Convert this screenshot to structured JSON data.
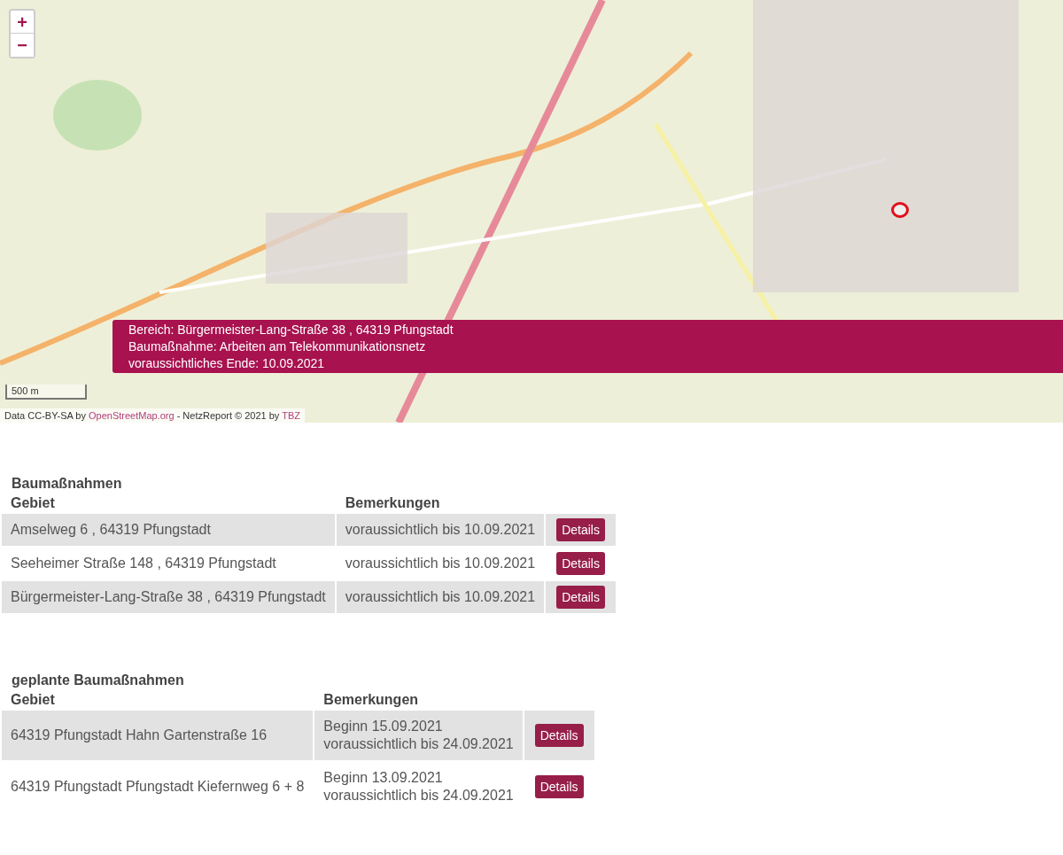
{
  "map": {
    "zoom_controls": [
      "+",
      "−"
    ],
    "tooltip": [
      "Bereich: Bürgermeister-Lang-Straße 38 , 64319 Pfungstadt",
      "Baumaßnahme: Arbeiten am Telekommunikationsnetz",
      "voraussichtliches Ende: 10.09.2021"
    ],
    "scale": "500 m",
    "attribution": [
      {
        "kind": "text",
        "text": "Data CC-BY-SA by "
      },
      {
        "kind": "link",
        "text": "OpenStreetMap.org"
      },
      {
        "kind": "text",
        "text": " - NetzReport © 2021 by "
      },
      {
        "kind": "link",
        "text": "TBZ"
      }
    ]
  },
  "tables": [
    {
      "title": "Baumaßnahmen",
      "columns": [
        "Gebiet",
        "Bemerkungen"
      ],
      "rows": [
        {
          "gebiet": "Amselweg 6 , 64319 Pfungstadt",
          "bemerkungen": [
            "voraussichtlich bis 10.09.2021"
          ],
          "button": "Details"
        },
        {
          "gebiet": "Seeheimer Straße 148 , 64319 Pfungstadt",
          "bemerkungen": [
            "voraussichtlich bis 10.09.2021"
          ],
          "button": "Details"
        },
        {
          "gebiet": "Bürgermeister-Lang-Straße 38 , 64319 Pfungstadt",
          "bemerkungen": [
            "voraussichtlich bis 10.09.2021"
          ],
          "button": "Details"
        }
      ]
    },
    {
      "title": "geplante Baumaßnahmen",
      "columns": [
        "Gebiet",
        "Bemerkungen"
      ],
      "rows": [
        {
          "gebiet": "64319 Pfungstadt Hahn Gartenstraße 16",
          "bemerkungen": [
            "Beginn 15.09.2021",
            "voraussichtlich bis 24.09.2021"
          ],
          "button": "Details"
        },
        {
          "gebiet": "64319 Pfungstadt Pfungstadt Kiefernweg 6 + 8",
          "bemerkungen": [
            "Beginn 13.09.2021",
            "voraussichtlich bis 24.09.2021"
          ],
          "button": "Details"
        }
      ]
    }
  ]
}
